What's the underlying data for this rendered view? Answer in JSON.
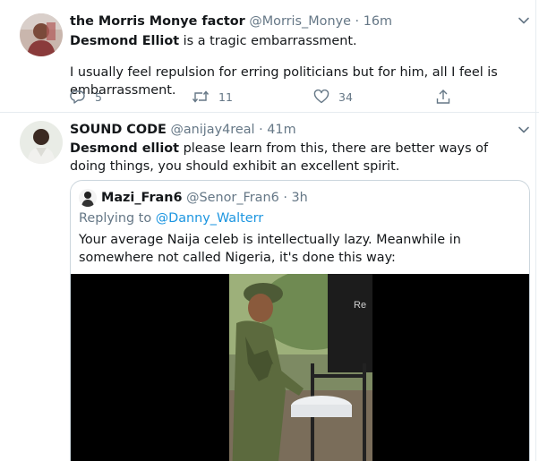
{
  "tweets": [
    {
      "display_name": "the Morris Monye factor",
      "handle": "@Morris_Monye",
      "separator": "·",
      "time": "16m",
      "text_bold": "Desmond Elliot",
      "text_rest": " is a tragic embarrassment.",
      "text_para2": "I usually feel repulsion for erring politicians but for him, all I feel is embarrassment.",
      "actions": {
        "reply_count": "5",
        "retweet_count": "11",
        "like_count": "34"
      }
    },
    {
      "display_name": "SOUND CODE",
      "handle": "@anijay4real",
      "separator": "·",
      "time": "41m",
      "text_bold": "Desmond elliot",
      "text_rest": " please learn from this, there are better ways of doing things, you should exhibit an excellent spirit.",
      "quote": {
        "display_name": "Mazi_Fran6",
        "handle": "@Senor_Fran6",
        "separator": "·",
        "time": "3h",
        "replying_prefix": "Replying to ",
        "replying_to": "@Danny_Walterr",
        "text": "Your average Naija celeb is intellectually lazy. Meanwhile in somewhere not called Nigeria, it's done this way:",
        "media_sign_text": "Re"
      }
    }
  ],
  "icons": {
    "reply": "reply-icon",
    "retweet": "retweet-icon",
    "like": "heart-icon",
    "share": "share-icon",
    "more": "chevron-down-icon"
  },
  "colors": {
    "secondary_text": "#657786",
    "link": "#1b95e0",
    "border": "#e6ecf0"
  }
}
